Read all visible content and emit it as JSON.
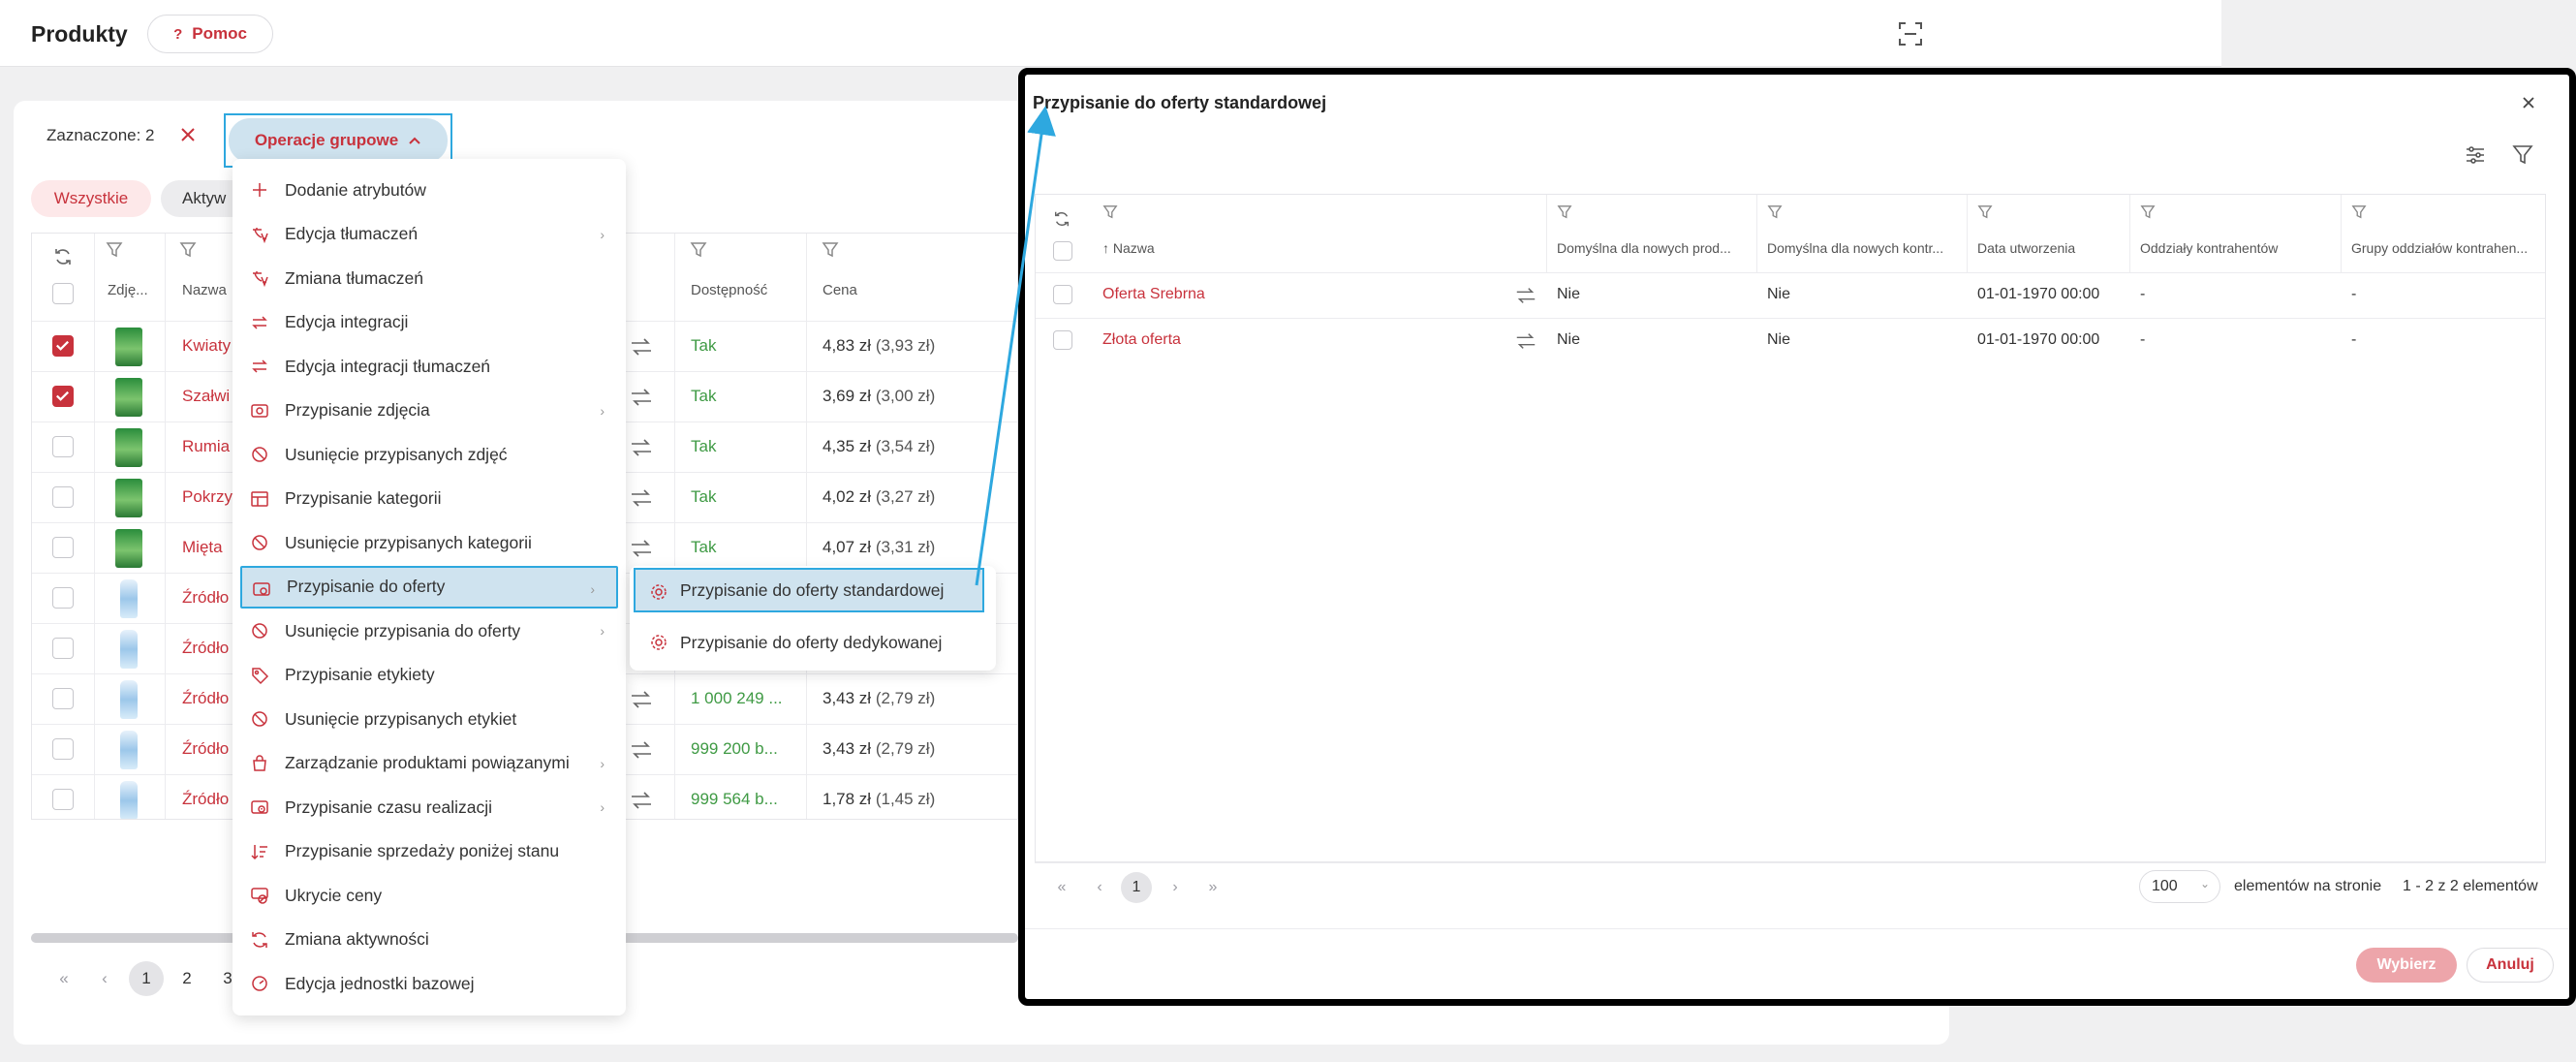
{
  "header": {
    "title": "Produkty",
    "help_label": "Pomoc",
    "help_icon": "?"
  },
  "toolbar": {
    "selected_label": "Zaznaczone: 2",
    "group_ops_label": "Operacje grupowe"
  },
  "filters": {
    "all_label": "Wszystkie",
    "active_label": "Aktyw"
  },
  "table": {
    "headers": {
      "photo": "Zdję...",
      "name": "Nazwa",
      "availability": "Dostępność",
      "price": "Cena"
    },
    "rows": [
      {
        "name": "Kwiaty",
        "checked": true,
        "thumb": "green",
        "availability": "Tak",
        "price": "4,83 zł",
        "net": "(3,93 zł)"
      },
      {
        "name": "Szałwi",
        "checked": true,
        "thumb": "green",
        "availability": "Tak",
        "price": "3,69 zł",
        "net": "(3,00 zł)"
      },
      {
        "name": "Rumia",
        "checked": false,
        "thumb": "green",
        "availability": "Tak",
        "price": "4,35 zł",
        "net": "(3,54 zł)"
      },
      {
        "name": "Pokrzy",
        "checked": false,
        "thumb": "green",
        "availability": "Tak",
        "price": "4,02 zł",
        "net": "(3,27 zł)"
      },
      {
        "name": "Mięta",
        "checked": false,
        "thumb": "green",
        "availability": "Tak",
        "price": "4,07 zł",
        "net": "(3,31 zł)"
      },
      {
        "name": "Źródło",
        "checked": false,
        "thumb": "bottle",
        "availability": "",
        "price": "",
        "net": ""
      },
      {
        "name": "Źródło",
        "checked": false,
        "thumb": "bottle",
        "availability": "",
        "price": "",
        "net": ""
      },
      {
        "name": "Źródło",
        "checked": false,
        "thumb": "bottle",
        "availability": "1 000 249 ...",
        "price": "3,43 zł",
        "net": "(2,79 zł)"
      },
      {
        "name": "Źródło",
        "checked": false,
        "thumb": "bottle",
        "availability": "999 200 b...",
        "price": "3,43 zł",
        "net": "(2,79 zł)"
      },
      {
        "name": "Źródło",
        "checked": false,
        "thumb": "bottle",
        "availability": "999 564 b...",
        "price": "1,78 zł",
        "net": "(1,45 zł)"
      }
    ]
  },
  "pager": {
    "pages": [
      "1",
      "2",
      "3"
    ]
  },
  "group_menu": {
    "items": [
      {
        "label": "Dodanie atrybutów",
        "icon": "plus-icon",
        "submenu": false
      },
      {
        "label": "Edycja tłumaczeń",
        "icon": "translate-edit-icon",
        "submenu": true
      },
      {
        "label": "Zmiana tłumaczeń",
        "icon": "translate-icon",
        "submenu": false
      },
      {
        "label": "Edycja integracji",
        "icon": "swap-icon",
        "submenu": false
      },
      {
        "label": "Edycja integracji tłumaczeń",
        "icon": "swap-icon",
        "submenu": false
      },
      {
        "label": "Przypisanie zdjęcia",
        "icon": "image-icon",
        "submenu": true
      },
      {
        "label": "Usunięcie przypisanych zdjęć",
        "icon": "ban-icon",
        "submenu": false
      },
      {
        "label": "Przypisanie kategorii",
        "icon": "category-icon",
        "submenu": false
      },
      {
        "label": "Usunięcie przypisanych kategorii",
        "icon": "ban-icon",
        "submenu": false
      },
      {
        "label": "Przypisanie do oferty",
        "icon": "offer-icon",
        "submenu": true
      },
      {
        "label": "Usunięcie przypisania do oferty",
        "icon": "ban-icon",
        "submenu": true
      },
      {
        "label": "Przypisanie etykiety",
        "icon": "tag-icon",
        "submenu": false
      },
      {
        "label": "Usunięcie przypisanych etykiet",
        "icon": "ban-icon",
        "submenu": false
      },
      {
        "label": "Zarządzanie produktami powiązanymi",
        "icon": "bag-icon",
        "submenu": true
      },
      {
        "label": "Przypisanie czasu realizacji",
        "icon": "clock-icon",
        "submenu": true
      },
      {
        "label": "Przypisanie sprzedaży poniżej stanu",
        "icon": "sort-icon",
        "submenu": false
      },
      {
        "label": "Ukrycie ceny",
        "icon": "price-hide-icon",
        "submenu": false
      },
      {
        "label": "Zmiana aktywności",
        "icon": "refresh-icon",
        "submenu": false
      },
      {
        "label": "Edycja jednostki bazowej",
        "icon": "gauge-icon",
        "submenu": false
      }
    ]
  },
  "submenu": {
    "items": [
      "Przypisanie do oferty standardowej",
      "Przypisanie do oferty dedykowanej"
    ]
  },
  "modal": {
    "title": "Przypisanie do oferty standardowej",
    "headers": [
      "Nazwa",
      "Domyślna dla nowych prod...",
      "Domyślna dla nowych kontr...",
      "Data utworzenia",
      "Oddziały kontrahentów",
      "Grupy oddziałów kontrahen..."
    ],
    "rows": [
      {
        "name": "Oferta Srebrna",
        "default_products": "Nie",
        "default_clients": "Nie",
        "created": "01-01-1970 00:00",
        "branches": "-",
        "branch_groups": "-"
      },
      {
        "name": "Złota oferta",
        "default_products": "Nie",
        "default_clients": "Nie",
        "created": "01-01-1970 00:00",
        "branches": "-",
        "branch_groups": "-"
      }
    ],
    "pager": {
      "page": "1",
      "per_page": "100",
      "per_page_label": "elementów na stronie",
      "summary": "1 - 2 z 2 elementów"
    },
    "choose_label": "Wybierz",
    "cancel_label": "Anuluj"
  },
  "colors": {
    "accent": "#c8323c",
    "highlight": "#2ea8df",
    "success": "#3f9a44"
  }
}
